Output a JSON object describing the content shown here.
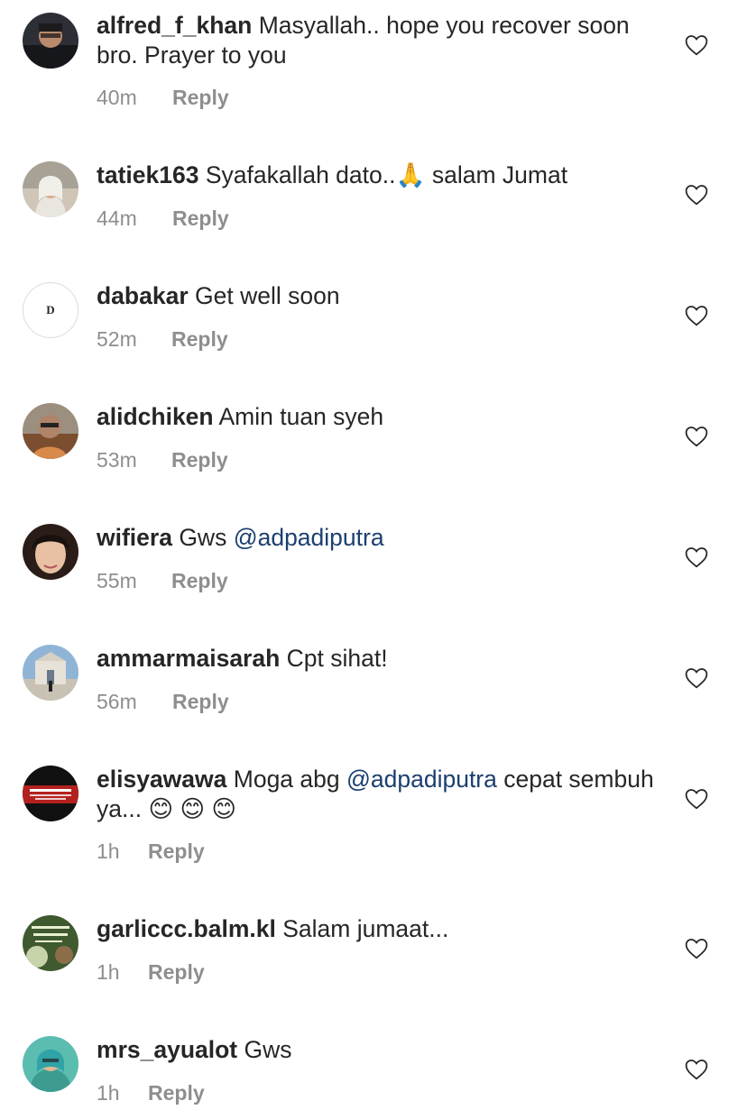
{
  "comments": [
    {
      "username": "alfred_f_khan",
      "text": " Masyallah.. hope you recover soon bro. Prayer to you",
      "time": "40m",
      "reply": "Reply"
    },
    {
      "username": "tatiek163",
      "text": " Syafakallah dato..",
      "emoji": "🙏",
      "text_after": " salam Jumat",
      "time": "44m",
      "reply": "Reply"
    },
    {
      "username": "dabakar",
      "avatar_letter": "D",
      "text": " Get well soon",
      "time": "52m",
      "reply": "Reply"
    },
    {
      "username": "alidchiken",
      "text": " Amin tuan syeh",
      "time": "53m",
      "reply": "Reply"
    },
    {
      "username": "wifiera",
      "text": " Gws ",
      "mention": "@adpadiputra",
      "time": "55m",
      "reply": "Reply"
    },
    {
      "username": "ammarmaisarah",
      "text": " Cpt sihat!",
      "time": "56m",
      "reply": "Reply"
    },
    {
      "username": "elisyawawa",
      "text": " Moga abg ",
      "mention": "@adpadiputra",
      "text_after": "  cepat sembuh ya... ",
      "emoji": "😊 😊 😊",
      "time": "1h",
      "reply": "Reply"
    },
    {
      "username": "garliccc.balm.kl",
      "text": " Salam jumaat...",
      "time": "1h",
      "reply": "Reply"
    },
    {
      "username": "mrs_ayualot",
      "text": " Gws",
      "time": "1h",
      "reply": "Reply"
    }
  ],
  "colors": {
    "username": "#262626",
    "meta": "#8e8e8e",
    "mention": "#1b3f6f",
    "heart": "#262626"
  },
  "icons": {
    "like": "heart-outline-icon"
  }
}
